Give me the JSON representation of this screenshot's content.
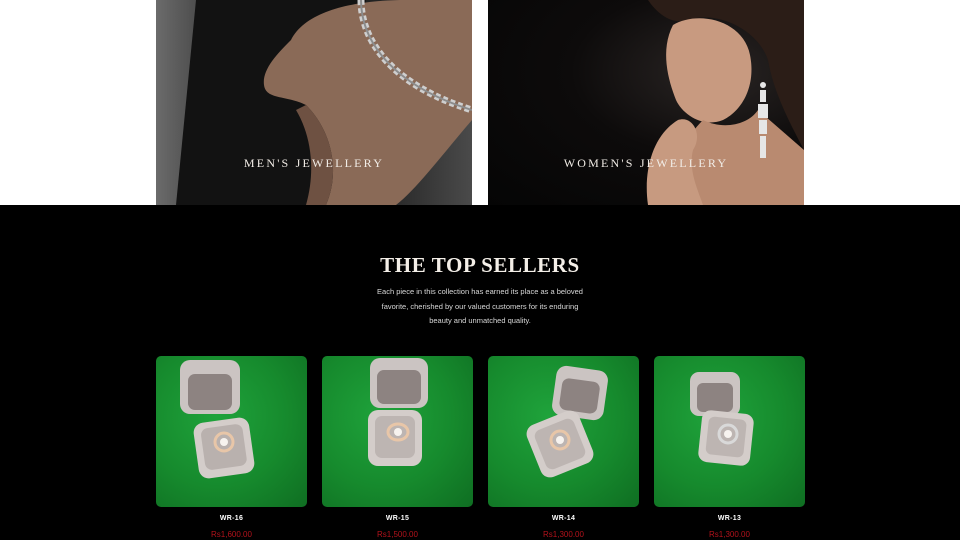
{
  "categories": [
    {
      "label": "MEN'S JEWELLERY"
    },
    {
      "label": "WOMEN'S JEWELLERY"
    }
  ],
  "top_sellers": {
    "title": "THE TOP SELLERS",
    "subtitle": "Each piece in this collection has earned its place as a beloved favorite, cherished by our valued customers for its enduring beauty and unmatched quality.",
    "products": [
      {
        "name": "WR-16",
        "price": "Rs1,600.00"
      },
      {
        "name": "WR-15",
        "price": "Rs1,500.00"
      },
      {
        "name": "WR-14",
        "price": "Rs1,300.00"
      },
      {
        "name": "WR-13",
        "price": "Rs1,300.00"
      }
    ]
  },
  "colors": {
    "background": "#000000",
    "price": "#b3121b",
    "product_backdrop": "#168a2d"
  }
}
